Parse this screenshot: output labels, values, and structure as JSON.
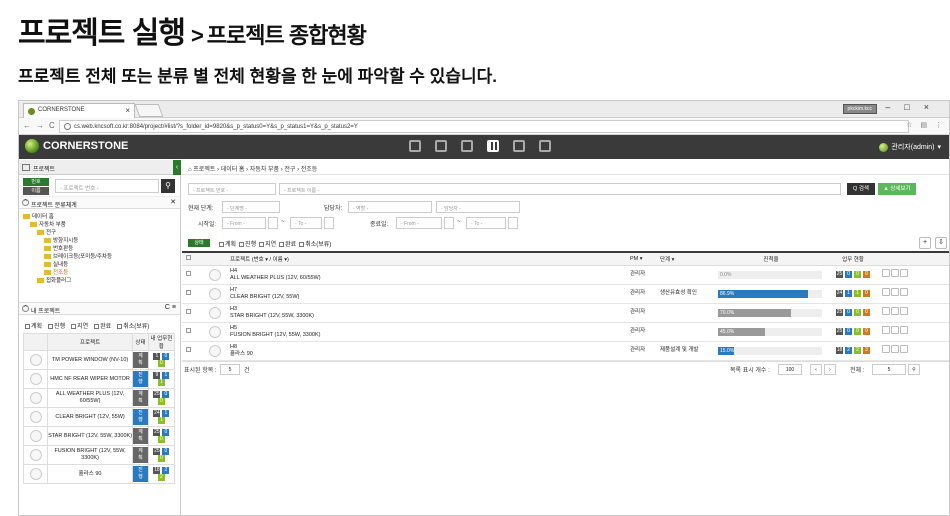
{
  "slide": {
    "title": "프로젝트 실행",
    "arrow": ">",
    "subtitle": "프로젝트 종합현황",
    "description": "프로젝트 전체 또는 분류 별 전체 현황을 한 눈에 파악할 수 있습니다."
  },
  "browser": {
    "tab_title": "CORNERSTONE",
    "tab_close": "×",
    "user_chip": "pkckim.kcc",
    "window_controls": "–□×",
    "nav_icons": "←→C",
    "url": "cs.web.kncsoft.co.kr:8084/project/#list/?s_folder_id=9820&s_p_status0=Y&s_p_status1=Y&s_p_status2=Y",
    "addr_icons": "☆ ▤ ⋮"
  },
  "app": {
    "brand": "CORNERSTONE",
    "user": "관리자(admin)",
    "user_caret": "▾"
  },
  "sidebar": {
    "header": "프로젝트",
    "collapse": "‹",
    "search_badges": [
      "번호",
      "이름"
    ],
    "search_placeholder": "- 프로젝트 번호 -",
    "search_icon": "⚲",
    "category_title": "프로젝트 분류체계",
    "category_toggle": "^",
    "category_close": "✕",
    "tree": [
      {
        "label": "데이터 홈",
        "level": 0
      },
      {
        "label": "자동차 부품",
        "level": 1
      },
      {
        "label": "전구",
        "level": 2
      },
      {
        "label": "방향지시등",
        "level": 3
      },
      {
        "label": "번호판등",
        "level": 3
      },
      {
        "label": "브레이크등(포미등/주차등",
        "level": 3
      },
      {
        "label": "실내등",
        "level": 3
      },
      {
        "label": "전조등",
        "level": 3,
        "selected": true
      },
      {
        "label": "접화플러그",
        "level": 2
      }
    ],
    "my_title": "내 프로젝트",
    "my_toggle": "^",
    "my_icons": "C ≡",
    "checks": [
      "계획",
      "진행",
      "지연",
      "완료",
      "취소(보류)"
    ],
    "my_cols": [
      "프로젝트",
      "상태",
      "내 업무현황"
    ],
    "my_rows": [
      {
        "name": "TM POWER WINDOW (NV-10)",
        "status": "계획",
        "stype": "plan",
        "counts": [
          "1",
          "0",
          "0"
        ]
      },
      {
        "name": "HMC NF REAR WIPER MOTOR",
        "status": "진행",
        "stype": "prog",
        "counts": [
          "9",
          "1",
          "1"
        ]
      },
      {
        "name": "ALL WEATHER PLUS (12V, 60/55W)",
        "status": "계획",
        "stype": "plan",
        "counts": [
          "25",
          "0",
          "0"
        ]
      },
      {
        "name": "CLEAR BRIGHT (12V, 55W)",
        "status": "진행",
        "stype": "prog",
        "counts": [
          "24",
          "1",
          "1"
        ]
      },
      {
        "name": "STAR BRIGHT (12V, 55W, 3300K)",
        "status": "계획",
        "stype": "plan",
        "counts": [
          "25",
          "0",
          "0"
        ]
      },
      {
        "name": "FUSION BRIGHT (12V, 55W, 3300K)",
        "status": "계획",
        "stype": "plan",
        "counts": [
          "25",
          "0",
          "0"
        ]
      },
      {
        "name": "흘라스 90",
        "status": "진행",
        "stype": "prog",
        "counts": [
          "18",
          "2",
          "2"
        ]
      }
    ]
  },
  "main": {
    "breadcrumb": "⌂ 프로젝트 › 데이터 홈 › 자동차 부품 › 전구 › 전조등",
    "no_placeholder": "- 프로젝트 번호 -",
    "name_placeholder": "- 프로젝트 이름 -",
    "search_btn": "Q 검색",
    "detail_btn": "▲ 상세보기",
    "stage_label": "현재 단계:",
    "stage_placeholder": "- 단계명 -",
    "manager_label": "담당자:",
    "role_placeholder": "- 역할 -",
    "manager_placeholder": "- 담당자 -",
    "start_label": "시작일:",
    "end_label": "종료일:",
    "from": "- From -",
    "to": "- To -",
    "tilde": "~",
    "status_tag": "상태",
    "status_checks": [
      "계획",
      "진행",
      "지연",
      "완료",
      "취소(보류)"
    ],
    "add_btn": "+",
    "export_btn": "⇩",
    "cols": [
      "프로젝트 (번호 ▾ / 이름 ▾)",
      "PM ▾",
      "단계 ▾",
      "진척율",
      "업무 현황"
    ],
    "rows": [
      {
        "no": "H4",
        "name": "ALL WEATHER PLUS (12V, 60/55W)",
        "pm": "관리자",
        "stage": "",
        "progress": 0,
        "ptext": "0.0%",
        "pcolor": "#dddddd",
        "counts": [
          "25",
          "0",
          "0",
          "0"
        ]
      },
      {
        "no": "H7",
        "name": "CLEAR BRIGHT (12V, 55W)",
        "pm": "관리자",
        "stage": "생산유효성 확인",
        "progress": 86.9,
        "ptext": "86.9%",
        "pcolor": "#2a7ac0",
        "counts": [
          "24",
          "1",
          "1",
          "0"
        ]
      },
      {
        "no": "H3",
        "name": "STAR BRIGHT (12V, 55W, 3300K)",
        "pm": "관리자",
        "stage": "",
        "progress": 70.0,
        "ptext": "70.0%",
        "pcolor": "#999999",
        "counts": [
          "25",
          "0",
          "0",
          "0"
        ]
      },
      {
        "no": "H5",
        "name": "FUSION BRIGHT (12V, 55W, 3300K)",
        "pm": "관리자",
        "stage": "",
        "progress": 45.0,
        "ptext": "45.0%",
        "pcolor": "#999999",
        "counts": [
          "25",
          "0",
          "0",
          "0"
        ]
      },
      {
        "no": "H8",
        "name": "흘라스 90",
        "pm": "관리자",
        "stage": "제품설계 및 개발",
        "progress": 15.0,
        "ptext": "15.0%",
        "pcolor": "#2a7ac0",
        "counts": [
          "18",
          "2",
          "2",
          "3"
        ]
      }
    ],
    "display_label": "표시된 항목 :",
    "display_count": "5",
    "display_unit": "건",
    "page_size_label": "목록 표시 개수 :",
    "page_size": "100",
    "prev": "‹",
    "next": "›",
    "total_label": "전체 :",
    "total": "5",
    "zoom_icon": "⚲"
  },
  "colors": {
    "accent": "#2b7a2b",
    "dark": "#3a3a3a",
    "blue": "#2a7ac0",
    "green": "#8cbf26"
  }
}
